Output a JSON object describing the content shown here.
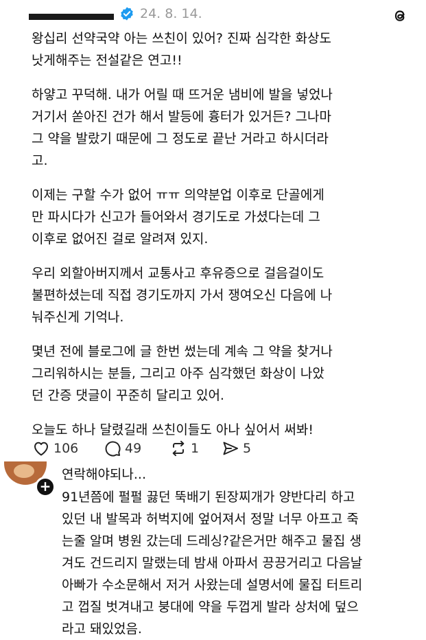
{
  "post": {
    "username": "",
    "date": "24. 8. 14.",
    "paragraphs": [
      "왕십리 선약국약 아는 쓰친이 있어? 진짜 심각한 화상도\n낫게해주는 전설같은 연고!!",
      "하얗고 꾸덕해. 내가 어릴 때 뜨거운 냄비에 발을 넣었나\n거기서 쏟아진 건가 해서 발등에 흉터가 있거든? 그나마\n그 약을 발랐기 때문에 그 정도로 끝난 거라고 하시더라\n고.",
      "이제는 구할 수가 없어 ㅠㅠ 의약분업 이후로 단골에게\n만 파시다가 신고가 들어와서 경기도로 가셨다는데 그\n이후로 없어진 걸로 알려져 있지.",
      "우리 외할아버지께서 교통사고 후유증으로 걸음걸이도\n불편하셨는데 직접 경기도까지 가서 쟁여오신 다음에 나\n눠주신게 기억나.",
      "몇년 전에 블로그에 글 한번 썼는데 계속 그 약을 찾거나\n그리워하시는 분들, 그리고 아주 심각했던 화상이 나았\n던 간증 댓글이 꾸준히 달리고 있어.",
      "오늘도 하나 달렸길래 쓰친이들도 아나 싶어서 써봐!"
    ],
    "actions": {
      "like_count": "106",
      "comment_count": "49",
      "repost_count": "1",
      "share_count": "5"
    }
  },
  "comment": {
    "username": "연락해야되나...",
    "text": "91년쯤에 펄펄 끓던 뚝배기 된장찌개가 양반다리 하고\n있던 내 발목과 허벅지에 엎어져서 정말 너무 아프고 죽\n는줄 알며 병원 갔는데 드레싱?같은거만 해주고 물집 생\n겨도 건드리지 말랬는데 밤새 아파서 끙끙거리고 다음날\n아빠가 수소문해서 저거 사왔는데 설명서에 물집 터트리\n고 껍질 벗겨내고 붕대에 약을 두껍게 발라 상처에 덮으\n라고 돼있었음.",
    "follow_badge": "+"
  },
  "icons": {
    "verified": "verified-badge-icon",
    "threads": "threads-logo-icon",
    "like": "heart-icon",
    "comment": "comment-bubble-icon",
    "repost": "repost-icon",
    "share": "share-send-icon"
  },
  "colors": {
    "verified_blue": "#1d9bf0",
    "date_gray": "#999999",
    "text": "#111111"
  }
}
